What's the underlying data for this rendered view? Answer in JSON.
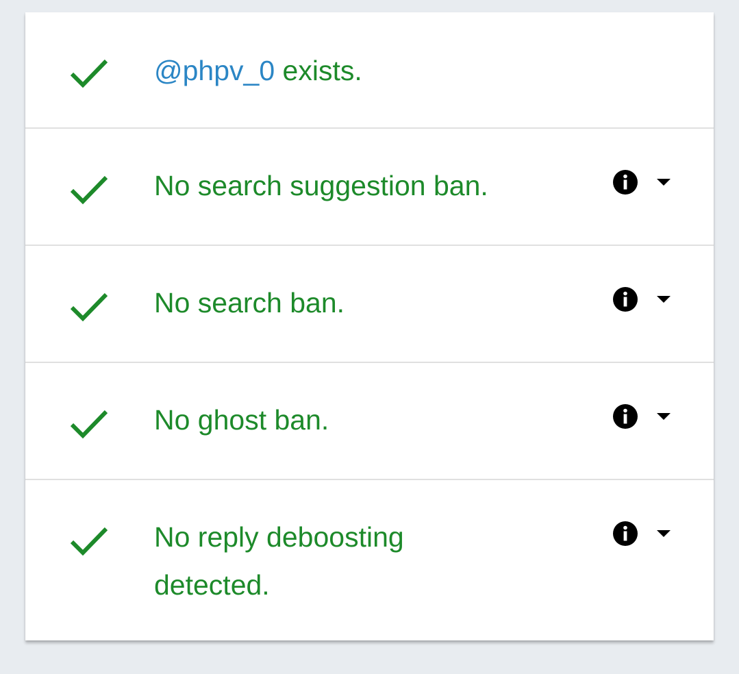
{
  "colors": {
    "success": "#1d8a2a",
    "link": "#2b86c5",
    "background": "#e8ecf0",
    "card": "#ffffff",
    "divider": "#e0e0e0"
  },
  "results": [
    {
      "status": "check-icon",
      "handle": "@phpv_0",
      "text": " exists."
    },
    {
      "status": "check-icon",
      "text": "No search suggestion ban.",
      "info_icon": "info-icon",
      "expand_icon": "caret-down-icon"
    },
    {
      "status": "check-icon",
      "text": "No search ban.",
      "info_icon": "info-icon",
      "expand_icon": "caret-down-icon"
    },
    {
      "status": "check-icon",
      "text": "No ghost ban.",
      "info_icon": "info-icon",
      "expand_icon": "caret-down-icon"
    },
    {
      "status": "check-icon",
      "text": "No reply deboosting detected.",
      "info_icon": "info-icon",
      "expand_icon": "caret-down-icon"
    }
  ]
}
